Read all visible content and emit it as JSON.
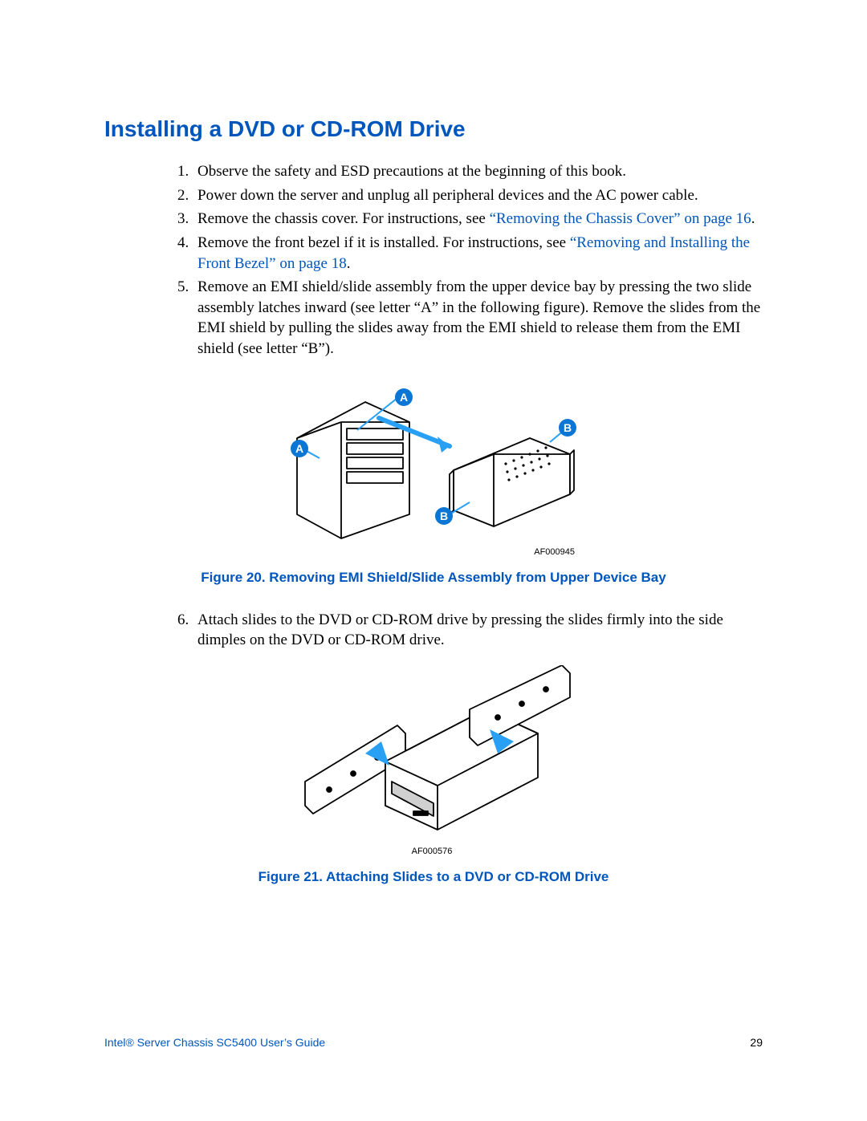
{
  "heading": "Installing a DVD or CD-ROM Drive",
  "steps": {
    "s1": "Observe the safety and ESD precautions at the beginning of this book.",
    "s2": "Power down the server and unplug all peripheral devices and the AC power cable.",
    "s3_a": "Remove the chassis cover. For instructions, see ",
    "s3_link": "“Removing the Chassis Cover” on page 16",
    "s3_b": ".",
    "s4_a": "Remove the front bezel if it is installed. For instructions, see ",
    "s4_link": "“Removing and Installing the Front Bezel” on page 18",
    "s4_b": ".",
    "s5": "Remove an EMI shield/slide assembly from the upper device bay by pressing the two slide assembly latches inward (see letter “A” in the following figure). Remove the slides from the EMI shield by pulling the slides away from the EMI shield to release them from the EMI shield (see letter “B”).",
    "s6": "Attach slides to the DVD or CD-ROM drive by pressing the slides firmly into the side dimples on the DVD or CD-ROM drive."
  },
  "figure20": {
    "refnum": "AF000945",
    "caption": "Figure 20. Removing EMI Shield/Slide Assembly from Upper Device Bay",
    "callouts": {
      "A": "A",
      "B": "B"
    }
  },
  "figure21": {
    "refnum": "AF000576",
    "caption": "Figure 21. Attaching Slides to a DVD or CD-ROM Drive"
  },
  "footer": {
    "guide": "Intel® Server Chassis SC5400 User’s Guide",
    "page": "29"
  }
}
